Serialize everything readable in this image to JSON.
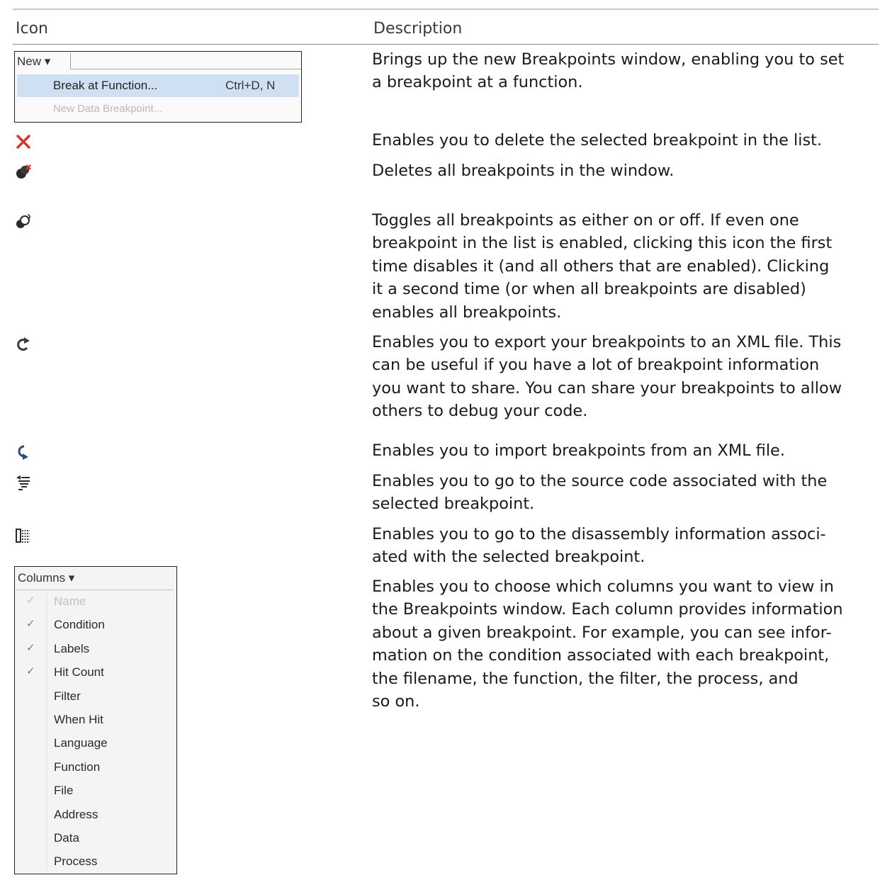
{
  "header": {
    "icon": "Icon",
    "description": "Description"
  },
  "new_menu": {
    "button": "New ▾",
    "item_label": "Break at Function...",
    "item_shortcut": "Ctrl+D, N",
    "disabled_item": "New Data Breakpoint..."
  },
  "rows": [
    {
      "icon": "new-dropdown",
      "description": "Brings up the new Breakpoints window, enabling you to set\na breakpoint at a function."
    },
    {
      "icon": "delete-icon",
      "description": "Enables you to delete the selected breakpoint in the list."
    },
    {
      "icon": "delete-all-icon",
      "description": "Deletes all breakpoints in the window."
    },
    {
      "icon": "toggle-all-icon",
      "description": "Toggles all breakpoints as either on or off. If even one\nbreakpoint in the list is enabled, clicking this icon the first\ntime disables it (and all others that are enabled). Clicking\nit a second time (or when all breakpoints are disabled)\nenables all breakpoints."
    },
    {
      "icon": "export-icon",
      "description": "Enables you to export your breakpoints to an XML file. This\ncan be useful if you have a lot of breakpoint information\nyou want to share. You can share your breakpoints to allow\nothers to debug your code."
    },
    {
      "icon": "import-icon",
      "description": "Enables you to import breakpoints from an XML file."
    },
    {
      "icon": "go-to-source-icon",
      "description": "Enables you to go to the source code associated with the\nselected breakpoint."
    },
    {
      "icon": "go-to-disassembly-icon",
      "description": "Enables you to go to the disassembly information associ-\nated with the selected breakpoint."
    },
    {
      "icon": "columns-dropdown",
      "description": "Enables you to choose which columns you want to view in\nthe Breakpoints window. Each column provides information\nabout a given breakpoint. For example, you can see infor-\nmation on the condition associated with each breakpoint,\nthe filename, the function, the filter, the process, and\nso on."
    }
  ],
  "columns_menu": {
    "button": "Columns ▾",
    "items": [
      {
        "label": "Name",
        "check": "✓"
      },
      {
        "label": "Condition",
        "check": "✓"
      },
      {
        "label": "Labels",
        "check": "✓"
      },
      {
        "label": "Hit Count",
        "check": "✓"
      },
      {
        "label": "Filter",
        "check": ""
      },
      {
        "label": "When Hit",
        "check": ""
      },
      {
        "label": "Language",
        "check": ""
      },
      {
        "label": "Function",
        "check": ""
      },
      {
        "label": "File",
        "check": ""
      },
      {
        "label": "Address",
        "check": ""
      },
      {
        "label": "Data",
        "check": ""
      },
      {
        "label": "Process",
        "check": ""
      }
    ]
  },
  "colors": {
    "delete_red": "#d8322c",
    "menu_highlight": "#cfe0f3",
    "rule": "#8a8a8a"
  }
}
